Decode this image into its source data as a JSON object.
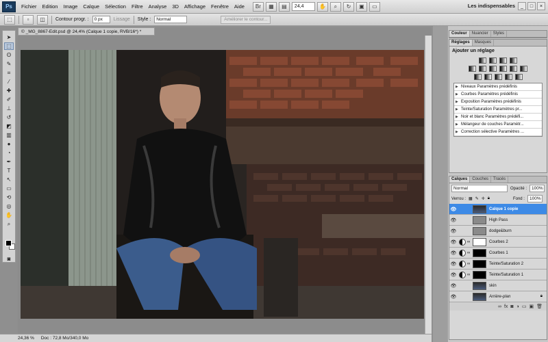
{
  "app": {
    "logo": "Ps",
    "menus": [
      "Fichier",
      "Edition",
      "Image",
      "Calque",
      "Sélection",
      "Filtre",
      "Analyse",
      "3D",
      "Affichage",
      "Fenêtre",
      "Aide"
    ],
    "zoom": "24,4",
    "workspace": "Les indispensables"
  },
  "options": {
    "contour_label": "Contour progr. :",
    "contour_value": "0 px",
    "lissage": "Lissage",
    "style_label": "Style :",
    "style_value": "Normal",
    "ameliorer": "Améliorer le contour..."
  },
  "document": {
    "tab_title": "© _MG_8867-Edit.psd @ 24,4% (Calque 1 copie, RVB/16*) *",
    "status_zoom": "24,36 %",
    "status_doc": "Doc : 72,8 Mo/340,0 Mo"
  },
  "panels": {
    "top_tabs": [
      "Couleur",
      "Nuancier",
      "Styles"
    ],
    "adj_tabs": [
      "Réglages",
      "Masques"
    ],
    "adj_title": "Ajouter un réglage",
    "presets": [
      "Niveaux Paramètres prédéfinis",
      "Courbes Paramètres prédéfinis",
      "Exposition Paramètres prédéfinis",
      "Teinte/Saturation Paramètres pr...",
      "Noir et blanc Paramètres prédéfi...",
      "Mélangeur de couches Paramètr...",
      "Correction sélective Paramètres ..."
    ],
    "layer_tabs": [
      "Calques",
      "Couches",
      "Tracés"
    ],
    "blend_mode": "Normal",
    "opacity_label": "Opacité :",
    "opacity_value": "100%",
    "lock_label": "Verrou :",
    "fill_label": "Fond :",
    "fill_value": "100%",
    "layers": [
      {
        "name": "Calque 1 copie",
        "selected": true,
        "thumb": "photo"
      },
      {
        "name": "High Pass",
        "thumb": "grey"
      },
      {
        "name": "dodge&burn",
        "thumb": "grey"
      },
      {
        "name": "Courbes 2",
        "thumb": "white",
        "adj": true
      },
      {
        "name": "Courbes 1",
        "thumb": "white",
        "adj": true
      },
      {
        "name": "Teinte/Saturation 2",
        "thumb": "white",
        "adj": true
      },
      {
        "name": "Teinte/Saturation 1",
        "thumb": "white",
        "adj": true
      },
      {
        "name": "skin",
        "thumb": "photo"
      },
      {
        "name": "Arrière-plan",
        "thumb": "photo",
        "italic": true,
        "locked": true
      }
    ]
  }
}
